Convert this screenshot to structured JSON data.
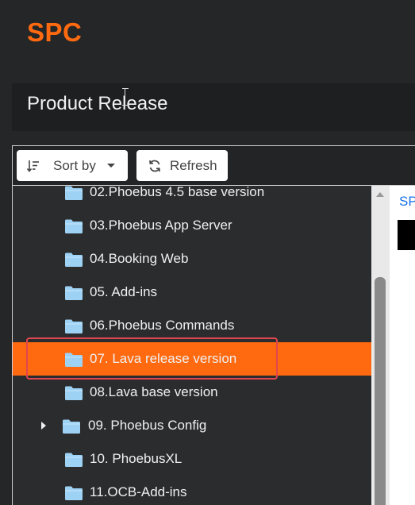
{
  "app": {
    "brand": "SPC"
  },
  "header": {
    "title": "Product Release"
  },
  "toolbar": {
    "sort_label": "Sort by",
    "sort_icon": "sort-icon",
    "refresh_label": "Refresh",
    "refresh_icon": "refresh-icon"
  },
  "tree": {
    "items": [
      {
        "label": "02.Phoebus 4.5 base version",
        "selected": false,
        "expandable": false
      },
      {
        "label": "03.Phoebus App Server",
        "selected": false,
        "expandable": false
      },
      {
        "label": "04.Booking Web",
        "selected": false,
        "expandable": false
      },
      {
        "label": "05. Add-ins",
        "selected": false,
        "expandable": false
      },
      {
        "label": "06.Phoebus Commands",
        "selected": false,
        "expandable": false
      },
      {
        "label": "07. Lava release version",
        "selected": true,
        "expandable": false
      },
      {
        "label": "08.Lava base version",
        "selected": false,
        "expandable": false
      },
      {
        "label": "09. Phoebus Config",
        "selected": false,
        "expandable": true
      },
      {
        "label": "10. PhoebusXL",
        "selected": false,
        "expandable": false
      },
      {
        "label": "11.OCB-Add-ins",
        "selected": false,
        "expandable": false
      }
    ]
  },
  "right_pane": {
    "tab_label": "SP"
  },
  "colors": {
    "accent": "#ff6a10",
    "folder": "#9ed2f5",
    "link": "#1a73e8",
    "highlight_border": "#e0464f"
  }
}
